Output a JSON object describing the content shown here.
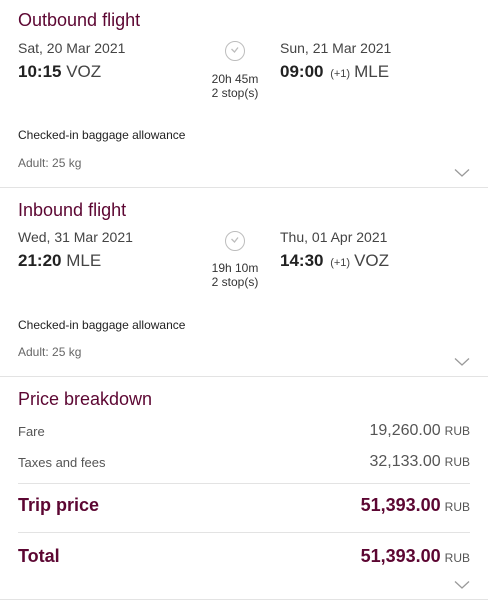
{
  "outbound": {
    "title": "Outbound flight",
    "dep_date": "Sat, 20 Mar 2021",
    "dep_time": "10:15",
    "dep_code": "VOZ",
    "duration": "20h 45m",
    "stops": "2 stop(s)",
    "arr_date": "Sun, 21 Mar 2021",
    "arr_time": "09:00",
    "arr_plus": "(+1)",
    "arr_code": "MLE",
    "baggage_label": "Checked-in baggage allowance",
    "baggage_value": "Adult: 25 kg"
  },
  "inbound": {
    "title": "Inbound flight",
    "dep_date": "Wed, 31 Mar 2021",
    "dep_time": "21:20",
    "dep_code": "MLE",
    "duration": "19h 10m",
    "stops": "2 stop(s)",
    "arr_date": "Thu, 01 Apr 2021",
    "arr_time": "14:30",
    "arr_plus": "(+1)",
    "arr_code": "VOZ",
    "baggage_label": "Checked-in baggage allowance",
    "baggage_value": "Adult: 25 kg"
  },
  "price": {
    "title": "Price breakdown",
    "fare_label": "Fare",
    "fare_value": "19,260.00",
    "taxes_label": "Taxes and fees",
    "taxes_value": "32,133.00",
    "trip_label": "Trip price",
    "trip_value": "51,393.00",
    "total_label": "Total",
    "total_value": "51,393.00",
    "currency": "RUB"
  },
  "colors": {
    "accent": "#5c0632",
    "divider": "#e3e3e3"
  }
}
